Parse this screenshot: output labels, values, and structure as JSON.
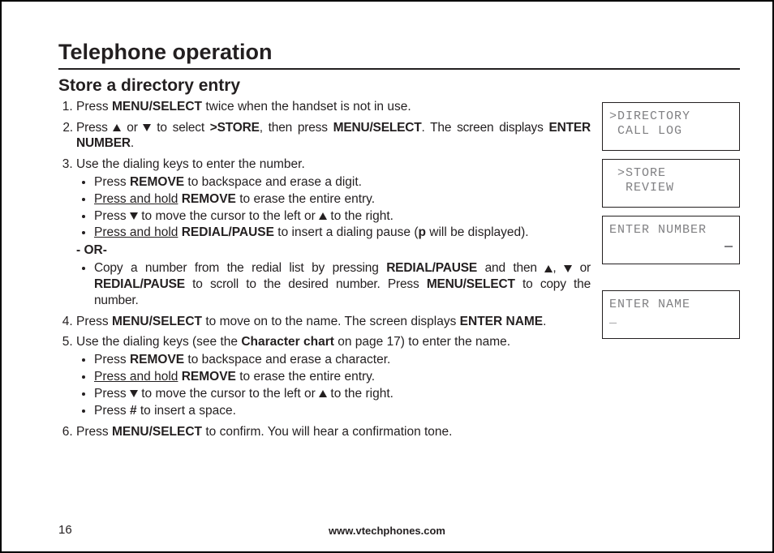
{
  "page": {
    "title": "Telephone operation",
    "subtitle": "Store a directory entry",
    "footer_url": "www.vtechphones.com",
    "page_number": "16"
  },
  "steps": {
    "s1a": "Press ",
    "s1b": "MENU/SELECT",
    "s1c": " twice when the handset is not in use.",
    "s2a": "Press ",
    "s2b": " or ",
    "s2c": " to select ",
    "s2d": ">STORE",
    "s2e": ", then press ",
    "s2f": "MENU/SELECT",
    "s2g": ". The screen displays ",
    "s2h": "ENTER NUMBER",
    "s2i": ".",
    "s3": "Use the dialing keys to enter the number.",
    "s3b1a": "Press ",
    "s3b1b": "REMOVE",
    "s3b1c": " to backspace and erase a digit.",
    "s3b2a": "Press and hold",
    "s3b2b": " ",
    "s3b2c": "REMOVE",
    "s3b2d": " to erase the entire entry.",
    "s3b3a": "Press ",
    "s3b3b": " to move the cursor to the left or ",
    "s3b3c": " to the right.",
    "s3b4a": "Press and hold",
    "s3b4b": " ",
    "s3b4c": "REDIAL/PAUSE",
    "s3b4d": " to insert a dialing pause (",
    "s3b4e": "p",
    "s3b4f": " will be displayed).",
    "or": "- OR-",
    "s3b5a": "Copy a number from the redial list by pressing ",
    "s3b5b": "REDIAL/PAUSE",
    "s3b5c": " and then ",
    "s3b5d": ", ",
    "s3b5e": " or ",
    "s3b5f": "REDIAL/PAUSE",
    "s3b5g": " to scroll to the desired number. Press ",
    "s3b5h": "MENU/SELECT",
    "s3b5i": " to copy the number.",
    "s4a": "Press ",
    "s4b": "MENU/SELECT",
    "s4c": " to move on to the name. The screen displays ",
    "s4d": "ENTER NAME",
    "s4e": ".",
    "s5a": "Use the dialing keys (see the ",
    "s5b": "Character chart",
    "s5c": " on page 17) to enter the name.",
    "s5b1a": "Press ",
    "s5b1b": "REMOVE",
    "s5b1c": " to backspace and erase a character.",
    "s5b2a": "Press and hold",
    "s5b2b": " ",
    "s5b2c": "REMOVE",
    "s5b2d": " to erase the entire entry.",
    "s5b3a": "Press ",
    "s5b3b": " to move the cursor to the left or ",
    "s5b3c": " to the right.",
    "s5b4a": "Press ",
    "s5b4b": "#",
    "s5b4c": " to insert a space.",
    "s6a": "Press ",
    "s6b": "MENU/SELECT",
    "s6c": " to confirm. You will hear a confirmation tone."
  },
  "screens": {
    "s1": ">DIRECTORY\n CALL LOG",
    "s2": " >STORE\n  REVIEW",
    "s3": "ENTER NUMBER",
    "s4": "ENTER NAME\n_"
  }
}
